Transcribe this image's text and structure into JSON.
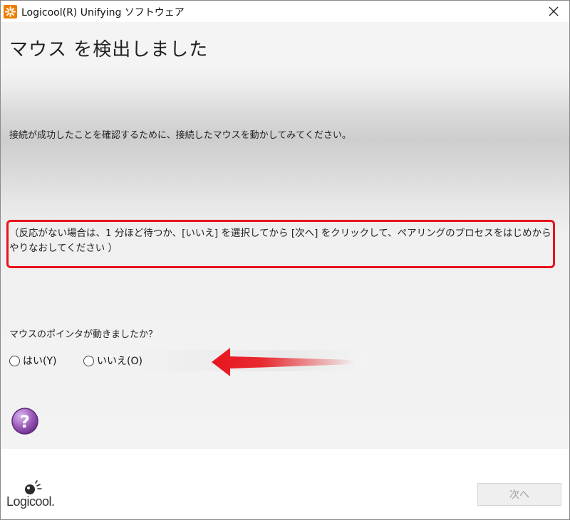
{
  "window": {
    "title": "Logicool(R) Unifying ソフトウェア"
  },
  "heading": "マウス を検出しました",
  "instruction": "接続が成功したことを確認するために、接続したマウスを動かしてみてください。",
  "note": "（反応がない場合は、1 分ほど待つか、[いいえ] を選択してから [次へ] をクリックして、ペアリングのプロセスをはじめからやりなおしてください ）",
  "question": "マウスのポインタが動きましたか？",
  "options": [
    {
      "label": "はい(Y)",
      "selected": false
    },
    {
      "label": "いいえ(O)",
      "selected": false
    }
  ],
  "logo": "Logicool.",
  "buttons": {
    "next_label": "次へ",
    "next_enabled": false
  },
  "icons": {
    "app": "logicool-unifying-icon",
    "close": "close-icon",
    "help": "help-icon",
    "arrow": "red-arrow-annotation"
  },
  "colors": {
    "annotation_red": "#e8141c",
    "app_orange": "#f07c00",
    "help_purple": "#9b59b6"
  }
}
